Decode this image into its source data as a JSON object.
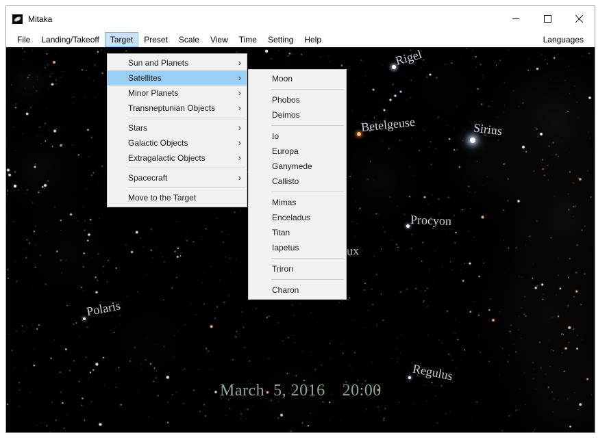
{
  "titlebar": {
    "title": "Mitaka",
    "icons": {
      "app": "galaxy-icon",
      "minimize": "minimize-icon",
      "maximize": "maximize-icon",
      "close": "close-icon"
    }
  },
  "menubar": {
    "items": [
      "File",
      "Landing/Takeoff",
      "Target",
      "Preset",
      "Scale",
      "View",
      "Time",
      "Setting",
      "Help"
    ],
    "active_item": "Target",
    "right_item": "Languages"
  },
  "target_menu": {
    "arrow_glyph": "›",
    "items": [
      {
        "label": "Sun and Planets",
        "has_submenu": true
      },
      {
        "label": "Satellites",
        "has_submenu": true,
        "highlighted": true
      },
      {
        "label": "Minor Planets",
        "has_submenu": true
      },
      {
        "label": "Transneptunian Objects",
        "has_submenu": true,
        "separator_after": true
      },
      {
        "label": "Stars",
        "has_submenu": true
      },
      {
        "label": "Galactic Objects",
        "has_submenu": true
      },
      {
        "label": "Extragalactic Objects",
        "has_submenu": true,
        "separator_after": true
      },
      {
        "label": "Spacecraft",
        "has_submenu": true,
        "separator_after": true
      },
      {
        "label": "Move to the Target",
        "has_submenu": false
      }
    ]
  },
  "satellites_menu": {
    "items": [
      {
        "label": "Moon",
        "separator_after": true
      },
      {
        "label": "Phobos"
      },
      {
        "label": "Deimos",
        "separator_after": true
      },
      {
        "label": "Io"
      },
      {
        "label": "Europa"
      },
      {
        "label": "Ganymede"
      },
      {
        "label": "Callisto",
        "separator_after": true
      },
      {
        "label": "Mimas"
      },
      {
        "label": "Enceladus"
      },
      {
        "label": "Titan"
      },
      {
        "label": "Iapetus",
        "separator_after": true
      },
      {
        "label": "Triron",
        "separator_after": true
      },
      {
        "label": "Charon"
      }
    ]
  },
  "sky": {
    "stars": [
      {
        "name": "Rigel"
      },
      {
        "name": "Betelgeuse"
      },
      {
        "name": "Sirius"
      },
      {
        "name": "Procyon"
      },
      {
        "name": "Pollux"
      },
      {
        "name": "Polaris"
      },
      {
        "name": "Regulus"
      }
    ],
    "date": "March  5, 2016",
    "time": "20:00"
  },
  "colors": {
    "menu_highlight": "#9ACEF2",
    "menubar_active_bg": "#CBE3F7",
    "menubar_active_border": "#86B8E0",
    "panel_bg": "#F2F2F2",
    "panel_border": "#CCCCCC",
    "date_text": "#8FA894",
    "star_label": "#C9CDD4"
  }
}
